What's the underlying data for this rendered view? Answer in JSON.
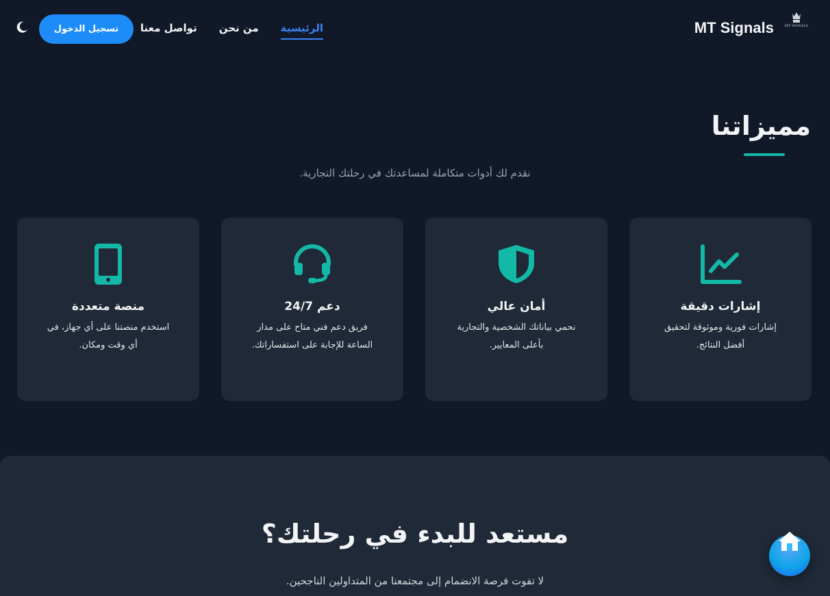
{
  "nav": {
    "brand_name": "MT Signals",
    "logo_text": "MT SIGNALS",
    "links": [
      {
        "label": "الرئيسية",
        "active": true
      },
      {
        "label": "من نحن",
        "active": false
      },
      {
        "label": "تواصل معنا",
        "active": false
      }
    ],
    "login_label": "تسجيل الدخول",
    "theme_icon": "moon-icon"
  },
  "features": {
    "title": "مميزاتنا",
    "subtitle": "نقدم لك أدوات متكاملة لمساعدتك في رحلتك التجارية.",
    "accent_color": "#14b8a6",
    "cards": [
      {
        "icon": "chart-line-icon",
        "title": "إشارات دقيقة",
        "text": "إشارات فورية وموثوقة لتحقيق أفضل النتائج."
      },
      {
        "icon": "shield-icon",
        "title": "أمان عالي",
        "text": "نحمي بياناتك الشخصية والتجارية بأعلى المعايير."
      },
      {
        "icon": "headset-icon",
        "title": "دعم 24/7",
        "text": "فريق دعم فني متاح على مدار الساعة للإجابة على استفساراتك."
      },
      {
        "icon": "mobile-icon",
        "title": "منصة متعددة",
        "text": "استخدم منصتنا على أي جهاز، في أي وقت ومكان."
      }
    ]
  },
  "cta": {
    "title": "مستعد للبدء في رحلتك؟",
    "subtitle": "لا تفوت فرصة الانضمام إلى مجتمعنا من المتداولين الناجحين."
  },
  "fab": {
    "icon": "home-icon"
  }
}
